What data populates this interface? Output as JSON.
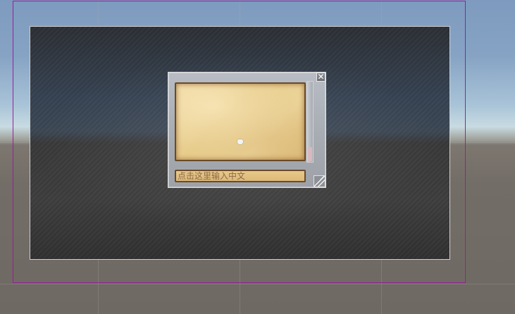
{
  "chat_window": {
    "close_glyph": "✕",
    "input": {
      "placeholder": "点击这里输入中文",
      "value": ""
    }
  },
  "icons": {
    "close": "close-icon",
    "resize": "resize-grip-icon",
    "pivot": "pivot-hand-icon"
  },
  "colors": {
    "camera_frame": "#9a1e9a",
    "parchment": "#e7cc8c",
    "parchment_border": "#6a4a2a",
    "window_frame": "#a9adb4",
    "scrollbar_thumb": "#d8b9c0"
  }
}
